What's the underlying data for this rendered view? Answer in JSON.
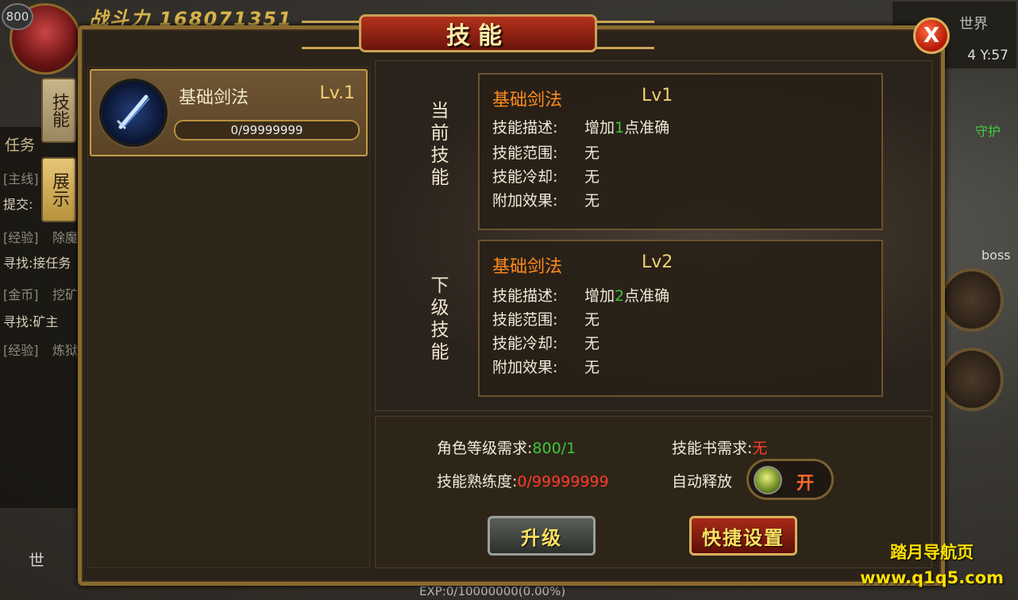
{
  "hud": {
    "level": "800",
    "power": "战斗力 168071351",
    "map_name": "世界",
    "map_coords": "4 Y:57",
    "exp": "EXP:0/10000000(0.00%)",
    "right_label": "守护",
    "boss_label": "boss",
    "world_chat_btn": "世"
  },
  "background_quests": [
    {
      "tag": "[主线]",
      "text": "提交:"
    },
    {
      "tag": "[经验]",
      "text": "除魔"
    },
    {
      "tag": "",
      "text": "寻找:接任务"
    },
    {
      "tag": "[金币]",
      "text": "挖矿"
    },
    {
      "tag": "",
      "text": "寻找:矿主"
    },
    {
      "tag": "[经验]",
      "text": "炼狱"
    }
  ],
  "task_button": "任务",
  "side_tabs": [
    {
      "label": "技能",
      "active": true
    },
    {
      "label": "展示",
      "active": false
    }
  ],
  "window": {
    "title": "技能",
    "close_label": "X"
  },
  "skill_list": [
    {
      "name": "基础剑法",
      "level": "Lv.1",
      "progress_text": "0/99999999",
      "progress": 0
    }
  ],
  "current_skill": {
    "section_label": [
      "当",
      "前",
      "技",
      "能"
    ],
    "name": "基础剑法",
    "level": "Lv1",
    "desc_label": "技能描述:",
    "desc_pre": "增加",
    "desc_num": "1",
    "desc_post": "点准确",
    "range_label": "技能范围:",
    "range_value": "无",
    "cooldown_label": "技能冷却:",
    "cooldown_value": "无",
    "effect_label": "附加效果:",
    "effect_value": "无"
  },
  "next_skill": {
    "section_label": [
      "下",
      "级",
      "技",
      "能"
    ],
    "name": "基础剑法",
    "level": "Lv2",
    "desc_label": "技能描述:",
    "desc_pre": "增加",
    "desc_num": "2",
    "desc_post": "点准确",
    "range_label": "技能范围:",
    "range_value": "无",
    "cooldown_label": "技能冷却:",
    "cooldown_value": "无",
    "effect_label": "附加效果:",
    "effect_value": "无"
  },
  "requirements": {
    "role_level_label": "角色等级需求:",
    "role_level_value": "800/1",
    "book_label": "技能书需求:",
    "book_value": "无",
    "proficiency_label": "技能熟练度:",
    "proficiency_value": "0/99999999",
    "auto_release_label": "自动释放",
    "auto_release_state": "开"
  },
  "buttons": {
    "upgrade": "升级",
    "hotkey": "快捷设置"
  },
  "watermark": {
    "line1": "踏月导航页",
    "line2": "www.q1q5.com"
  },
  "colors": {
    "skill_name_orange": "#ff8a1e",
    "value_green": "#39c939",
    "value_red": "#ff3b2b",
    "frame_gold": "#8a6a2e"
  }
}
